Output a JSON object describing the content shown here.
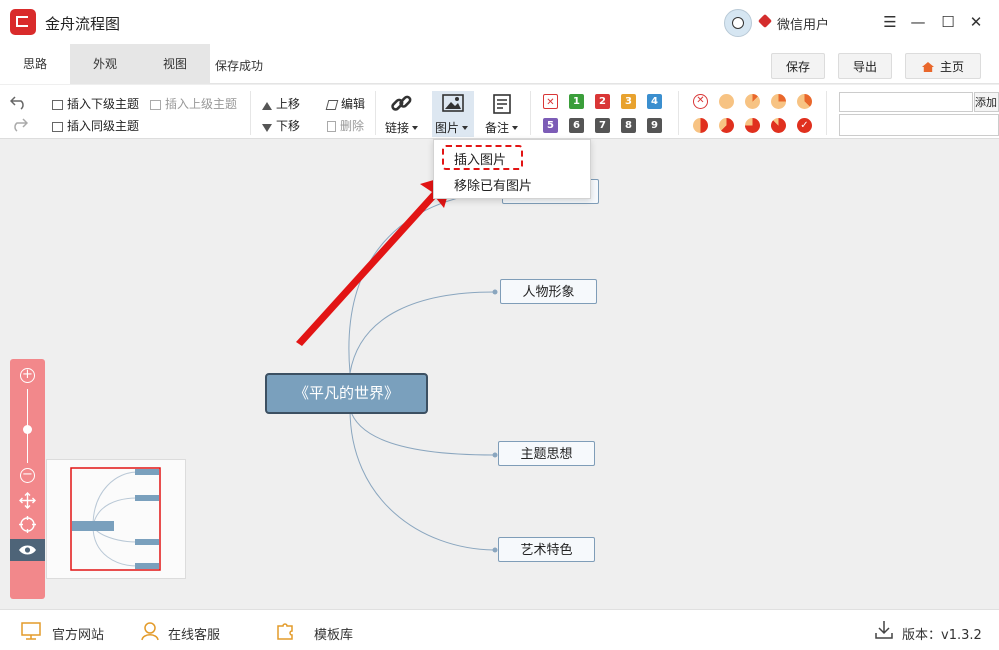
{
  "app": {
    "title": "金舟流程图",
    "brand_color": "#d92b2b",
    "accent_color": "#7aa0bd",
    "highlight_color": "#e21414"
  },
  "user": {
    "name": "微信用户",
    "avatar_icon": "panda-avatar-icon"
  },
  "window": {
    "menu_glyph": "☰",
    "minimize_glyph": "—",
    "maximize_glyph": "☐",
    "close_glyph": "✕"
  },
  "tabs": [
    {
      "label": "思路"
    },
    {
      "label": "外观"
    },
    {
      "label": "视图"
    }
  ],
  "status": {
    "save": "保存成功"
  },
  "top_buttons": {
    "save": "保存",
    "export": "导出",
    "home": "主页"
  },
  "ribbon": {
    "insert_child": "插入下级主题",
    "insert_parent": "插入上级主题",
    "insert_sibling": "插入同级主题",
    "move_up": "上移",
    "move_down": "下移",
    "edit": "编辑",
    "delete": "删除",
    "link": "链接",
    "image": "图片",
    "note": "备注",
    "add": "添加",
    "priorities": [
      "1",
      "2",
      "3",
      "4",
      "5",
      "6",
      "7",
      "8",
      "9"
    ],
    "priority_colors": [
      "#3a9e3a",
      "#d93636",
      "#e8a22e",
      "#3b8fcf",
      "#7c5cb6",
      "#555555",
      "#555555",
      "#555555",
      "#555555"
    ]
  },
  "image_dropdown": {
    "items": [
      "插入图片",
      "移除已有图片"
    ]
  },
  "mindmap": {
    "central": "《平凡的世界》",
    "branches": [
      "",
      "人物形象",
      "主题思想",
      "艺术特色"
    ]
  },
  "statusbar": {
    "website": "官方网站",
    "service": "在线客服",
    "templates": "模板库",
    "version_label": "版本：",
    "version": "v1.3.2"
  }
}
